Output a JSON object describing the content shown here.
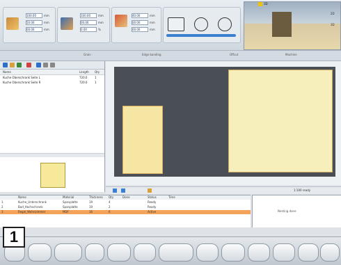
{
  "ribbon": {
    "groups": [
      {
        "fields": [
          "100.00",
          "50.00",
          "00.00"
        ],
        "units": [
          "mm",
          "mm",
          "mm"
        ]
      },
      {
        "fields": [
          "100.00",
          "00.00",
          "0.00"
        ],
        "units": [
          "mm",
          "mm",
          "%"
        ]
      },
      {
        "fields": [
          "40.00",
          "00.00",
          "00.00"
        ],
        "units": [
          "mm",
          "mm",
          "mm"
        ]
      }
    ],
    "group_labels": [
      "Grain",
      "Edge banding",
      "Offcut",
      "Machine"
    ],
    "accent_color": "#f2c200"
  },
  "preview": {
    "tab": "3D",
    "side_labels": [
      "2D",
      "3D"
    ]
  },
  "parts_list": {
    "columns": [
      "Name",
      "Length",
      "Qty"
    ],
    "rows": [
      {
        "name": "Kuche Oberschrank Seite L",
        "len": "720.0",
        "qty": "1"
      },
      {
        "name": "Kuche Oberschrank Seite R",
        "len": "720.0",
        "qty": "1"
      }
    ]
  },
  "jobs_table": {
    "columns": [
      "",
      "Name",
      "Material",
      "Thickness",
      "Qty",
      "Done",
      "",
      "Status",
      "Time"
    ],
    "rows": [
      {
        "id": "1",
        "name": "Kuche_Unterschrank",
        "material": "Spanplatte",
        "thick": "19",
        "qty": "4",
        "status": "Ready",
        "highlight": false
      },
      {
        "id": "2",
        "name": "Bad_Hochschrank",
        "material": "Spanplatte",
        "thick": "19",
        "qty": "2",
        "status": "Ready",
        "highlight": false
      },
      {
        "id": "3",
        "name": "Regal_Wohnzimmer",
        "material": "MDF",
        "thick": "16",
        "qty": "6",
        "status": "Active",
        "highlight": true
      }
    ]
  },
  "status_panel": {
    "text": "Nesting done"
  },
  "canvas_status": {
    "text": "1:100  ready"
  },
  "badge": {
    "label": "1"
  }
}
